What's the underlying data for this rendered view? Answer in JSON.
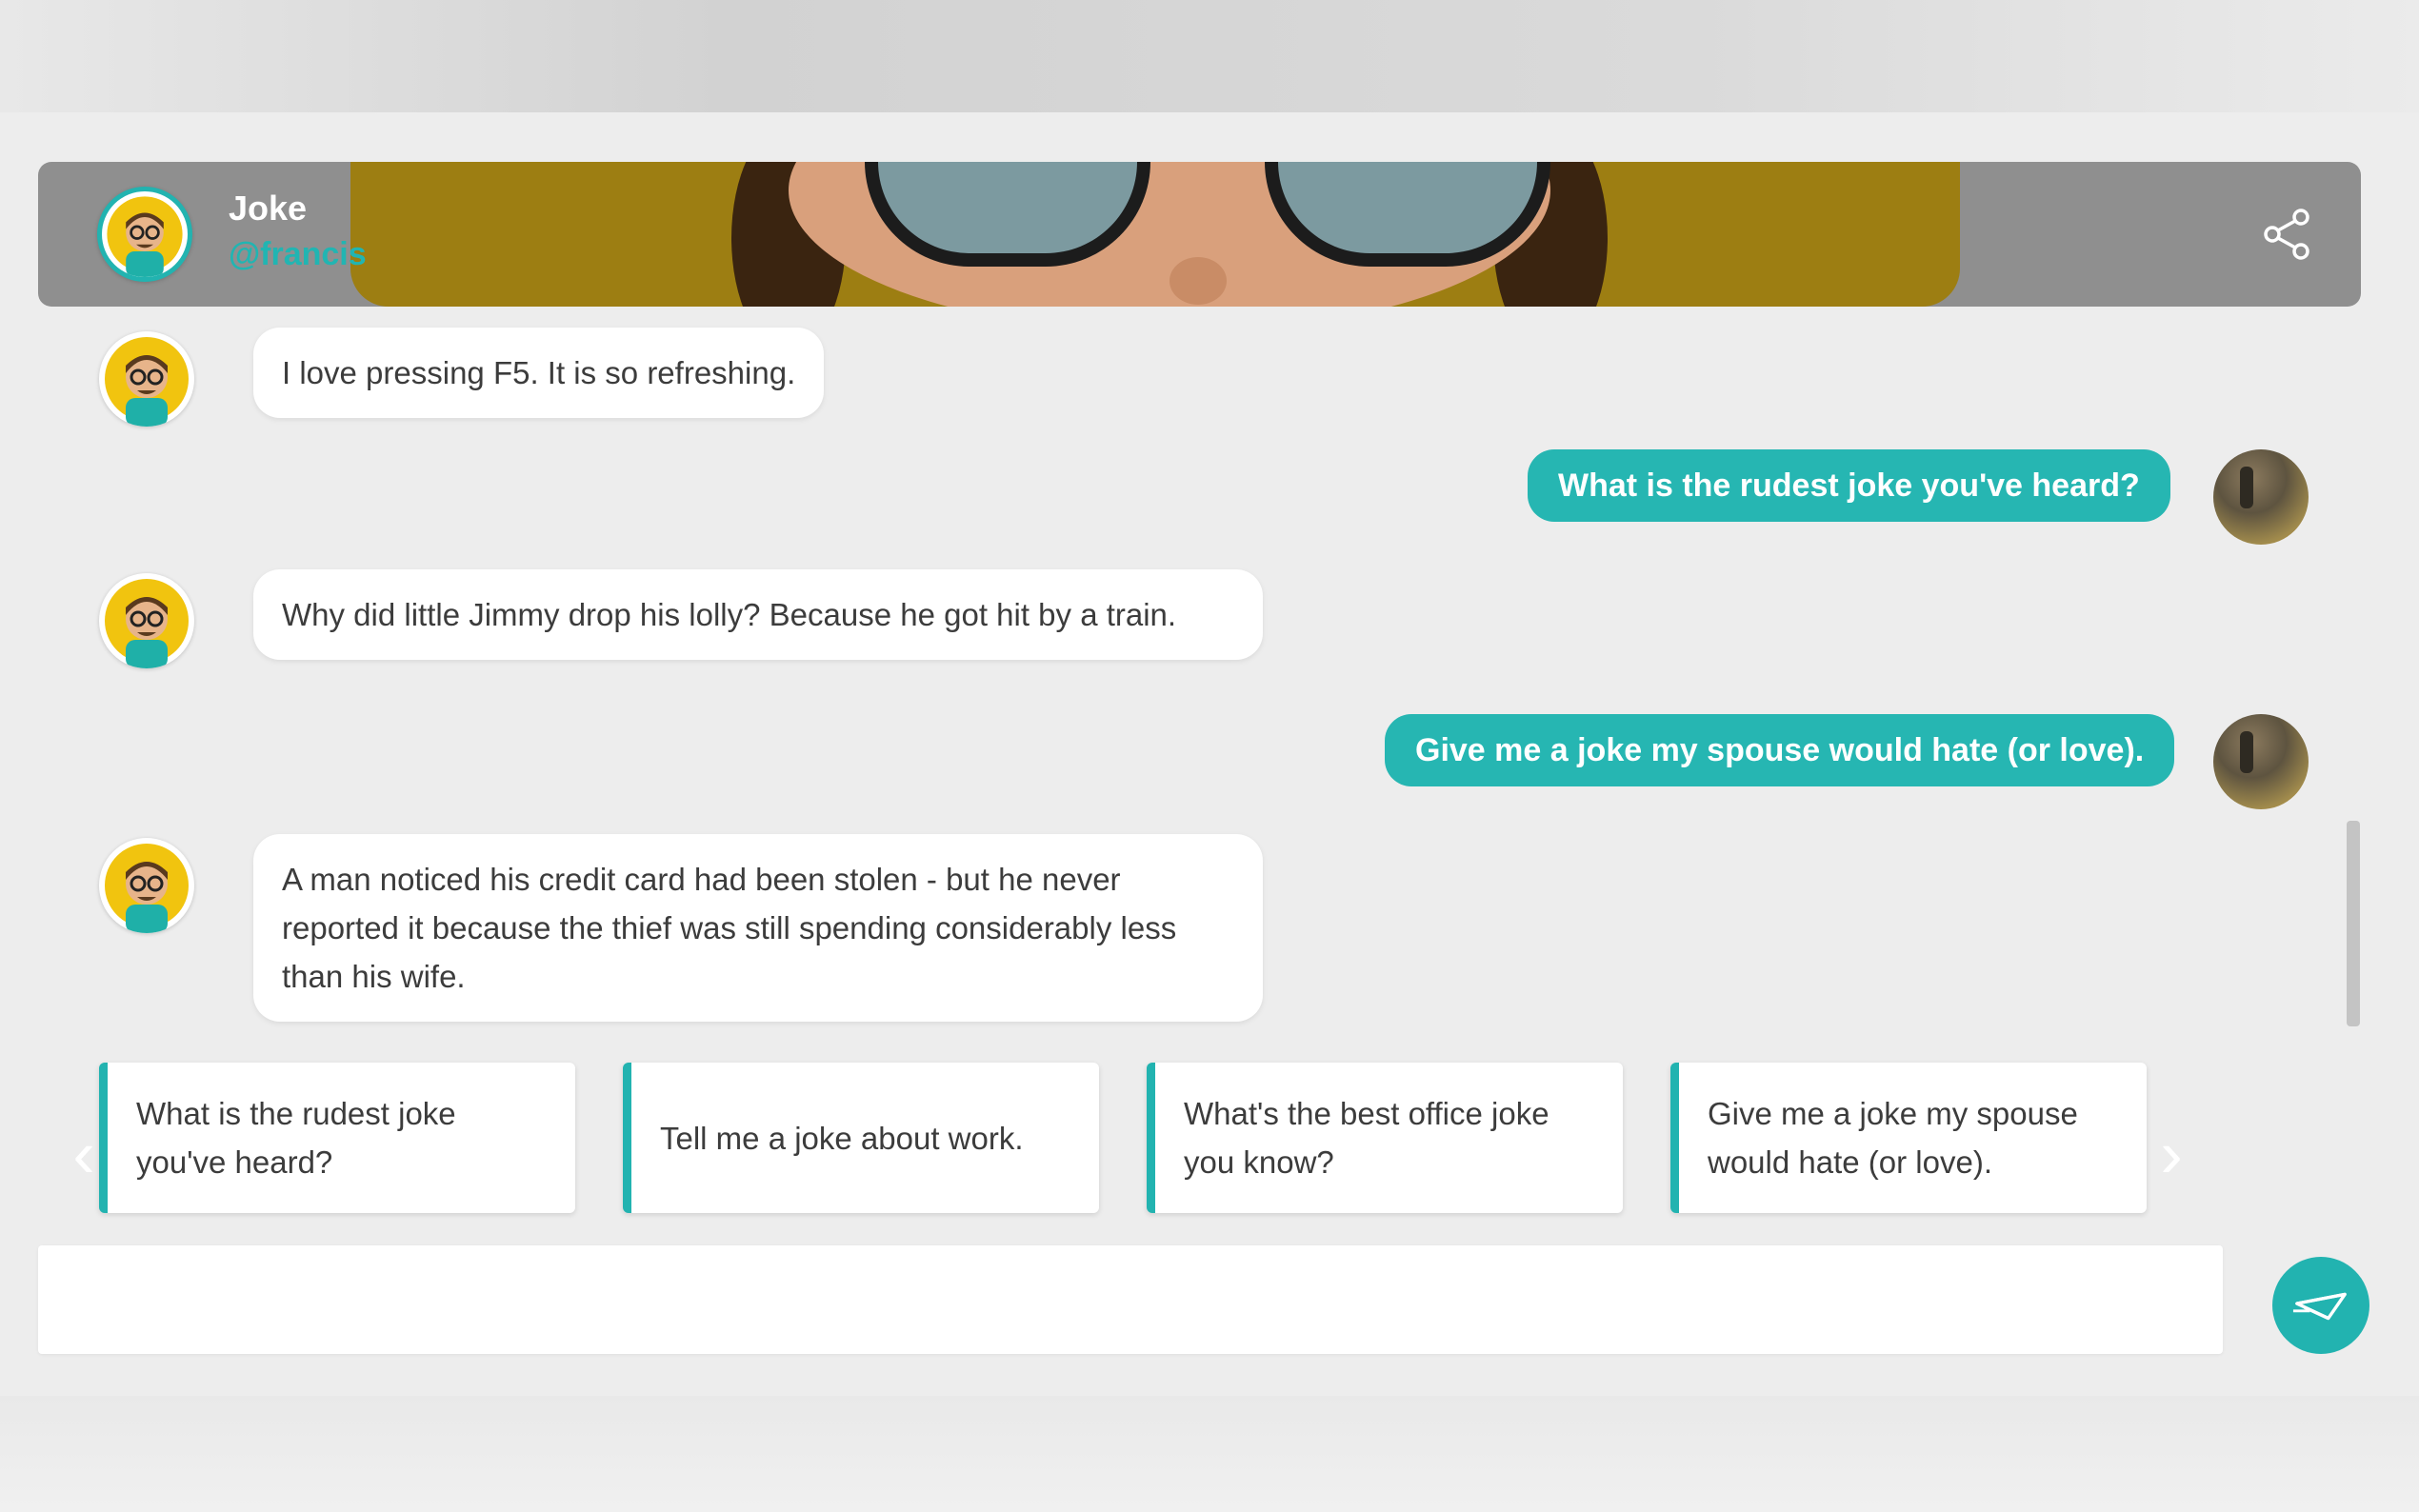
{
  "header": {
    "title": "Joke",
    "handle": "@francis"
  },
  "messages": [
    {
      "from": "bot",
      "text": "I love pressing F5. It is so refreshing."
    },
    {
      "from": "user",
      "text": "What is the rudest joke you've heard?"
    },
    {
      "from": "bot",
      "text": "Why did little Jimmy drop his lolly? Because he got hit by a train."
    },
    {
      "from": "user",
      "text": "Give me a joke my spouse would hate (or love)."
    },
    {
      "from": "bot",
      "text": "A man noticed his credit card had been stolen - but he never reported it because the thief was still spending considerably less than his wife."
    }
  ],
  "suggestions": [
    "What is the rudest joke you've heard?",
    "Tell me a joke about work.",
    "What's the best office joke you know?",
    "Give me a joke my spouse would hate (or love)."
  ],
  "composer": {
    "value": "",
    "placeholder": ""
  },
  "icons": {
    "share": "share-icon",
    "send": "paper-plane-icon",
    "prev": "chevron-left-icon",
    "next": "chevron-right-icon"
  },
  "colors": {
    "accent": "#22b3b0",
    "user_bubble": "#26b6b2",
    "bot_bubble": "#ffffff",
    "header_bg": "#8f8f8f",
    "background": "#ededed"
  }
}
